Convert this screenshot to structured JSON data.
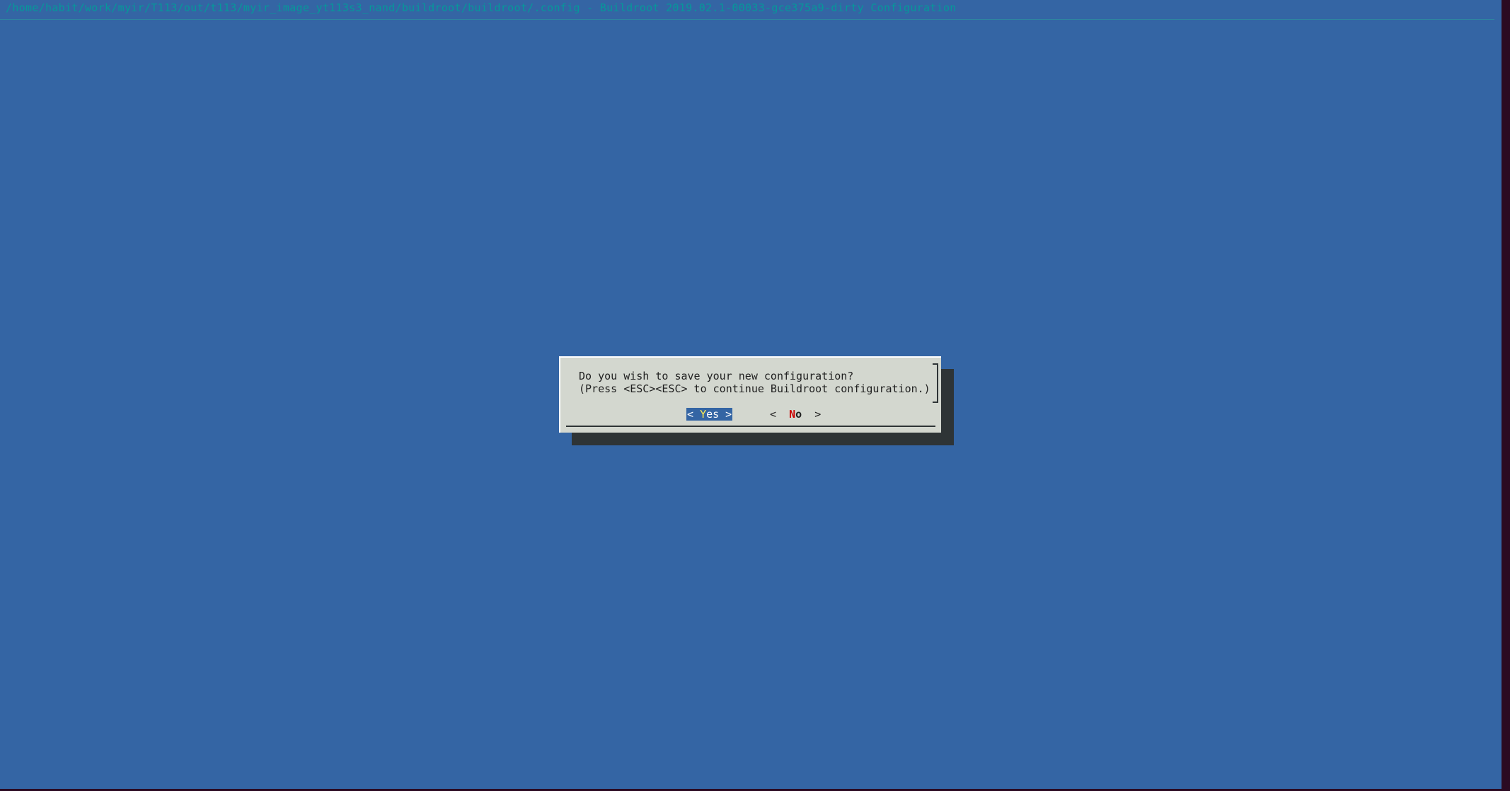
{
  "title": "/home/habit/work/myir/T113/out/t113/myir_image_yt113s3_nand/buildroot/buildroot/.config - Buildroot 2019.02.1-00033-gce375a9-dirty Configuration",
  "dialog": {
    "line1": "Do you wish to save your new configuration?",
    "line2": "(Press <ESC><ESC> to continue Buildroot configuration.)",
    "yes": {
      "open": "< ",
      "hot": "Y",
      "rest": "es",
      "close": " >"
    },
    "no": {
      "open": "<  ",
      "hot": "N",
      "rest": "o",
      "close": "  >"
    }
  },
  "colors": {
    "background": "#3465a4",
    "dialog": "#d3d7cf",
    "title": "#06989a",
    "yes_hotkey": "#fce94f",
    "no_hotkey": "#cc0000"
  }
}
